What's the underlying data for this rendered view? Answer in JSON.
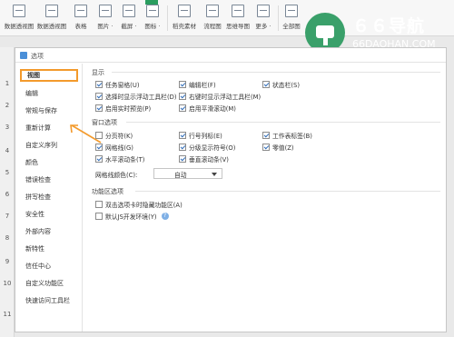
{
  "ribbon": {
    "buttons": [
      {
        "label": "数据透视图",
        "icon": "pivot-chart-icon"
      },
      {
        "label": "数据透视图",
        "icon": "pivot-table-icon"
      },
      {
        "label": "表格",
        "icon": "table-icon"
      },
      {
        "label": "图片 ·",
        "icon": "picture-icon"
      },
      {
        "label": "截屏 ·",
        "icon": "screenshot-icon"
      },
      {
        "label": "图标 ·",
        "icon": "icon-icon"
      },
      {
        "label": "稻壳素材",
        "icon": "material-icon"
      },
      {
        "label": "流程图",
        "icon": "flowchart-icon"
      },
      {
        "label": "思维导图",
        "icon": "mindmap-icon"
      },
      {
        "label": "更多 ·",
        "icon": "more-icon"
      },
      {
        "label": "全部图",
        "icon": "all-charts-icon"
      }
    ]
  },
  "watermark": {
    "title": "６６导航",
    "subtitle": "66DAOHAN.COM"
  },
  "row_numbers": [
    "1",
    "2",
    "3",
    "4",
    "5",
    "6",
    "7",
    "8",
    "9",
    "10",
    "11"
  ],
  "dialog": {
    "title": "选项",
    "nav_items": [
      "视图",
      "编辑",
      "常规与保存",
      "重新计算",
      "自定义序列",
      "颜色",
      "错误检查",
      "拼写检查",
      "安全性",
      "外部内容",
      "新特性",
      "信任中心",
      "自定义功能区",
      "快速访问工具栏"
    ],
    "sections": {
      "display": {
        "title": "显示",
        "options": [
          {
            "label": "任务窗格(U)",
            "checked": true
          },
          {
            "label": "编辑栏(F)",
            "checked": true
          },
          {
            "label": "状态栏(S)",
            "checked": true
          },
          {
            "label": "选择时显示浮动工具栏(D)",
            "checked": true
          },
          {
            "label": "右键时显示浮动工具栏(M)",
            "checked": true
          },
          {
            "label": "启用实时预览(P)",
            "checked": true
          },
          {
            "label": "启用平滑滚动(M)",
            "checked": true
          }
        ]
      },
      "window": {
        "title": "窗口选项",
        "options": [
          {
            "label": "分页符(K)",
            "checked": false
          },
          {
            "label": "行号列标(E)",
            "checked": true
          },
          {
            "label": "工作表标签(B)",
            "checked": true
          },
          {
            "label": "网格线(G)",
            "checked": true
          },
          {
            "label": "分级显示符号(O)",
            "checked": true
          },
          {
            "label": "零值(Z)",
            "checked": true
          },
          {
            "label": "水平滚动条(T)",
            "checked": true
          },
          {
            "label": "垂直滚动条(V)",
            "checked": true
          }
        ],
        "gridline_color_label": "网格线颜色(C):",
        "gridline_color_value": "自动"
      },
      "ribbon_options": {
        "title": "功能区选项",
        "options": [
          {
            "label": "双击选项卡时隐藏功能区(A)",
            "checked": false
          },
          {
            "label": "默认JS开发环境(Y)",
            "checked": false
          }
        ]
      }
    }
  },
  "colors": {
    "highlight": "#f39a2c",
    "brand_green": "#2a9d5f",
    "check_blue": "#2e6bb8"
  }
}
